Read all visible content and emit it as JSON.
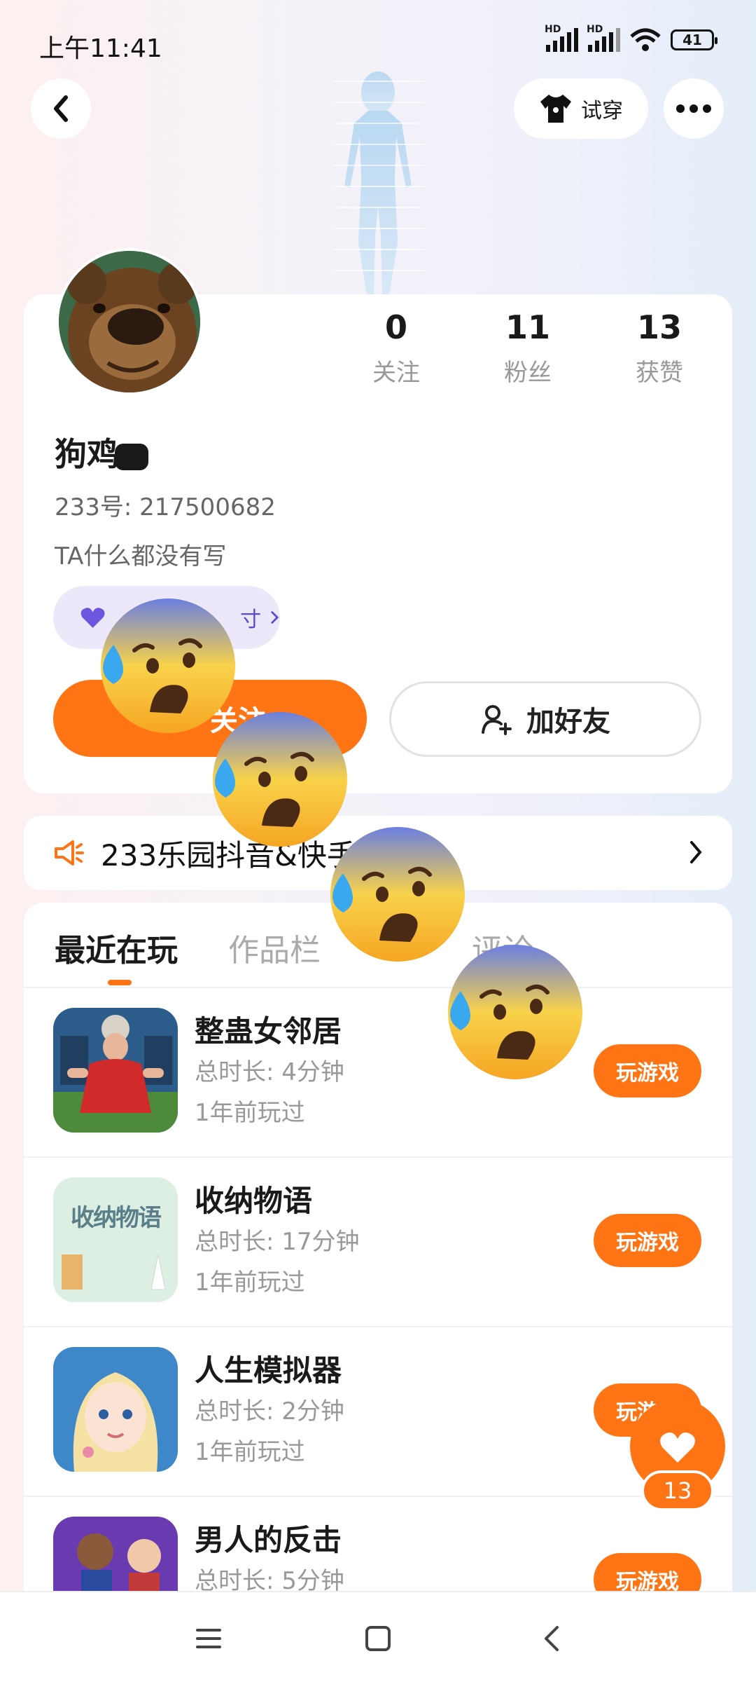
{
  "status_bar": {
    "time": "上午11:41",
    "battery": "41",
    "hd": "HD"
  },
  "header": {
    "tryon_label": "试穿"
  },
  "profile": {
    "stats": [
      {
        "value": "0",
        "label": "关注"
      },
      {
        "value": "11",
        "label": "粉丝"
      },
      {
        "value": "13",
        "label": "获赞"
      }
    ],
    "name": "狗鸡",
    "uid": "233号: 217500682",
    "bio": "TA什么都没有写",
    "tag_suffix": "寸",
    "follow_label": "关注",
    "addfriend_label": "加好友"
  },
  "notice": {
    "text": "233乐园抖音&快手指南"
  },
  "tabs": [
    {
      "label": "最近在玩"
    },
    {
      "label": "作品栏"
    },
    {
      "label": "评论"
    }
  ],
  "games": [
    {
      "name": "整蛊女邻居",
      "time": "总时长: 4分钟",
      "last": "1年前玩过",
      "play": "玩游戏"
    },
    {
      "name": "收纳物语",
      "time": "总时长: 17分钟",
      "last": "1年前玩过",
      "play": "玩游戏",
      "icon_text": "收纳物语"
    },
    {
      "name": "人生模拟器",
      "time": "总时长: 2分钟",
      "last": "1年前玩过",
      "play": "玩游戏"
    },
    {
      "name": "男人的反击",
      "time": "总时长: 5分钟",
      "last": "",
      "play": "玩游戏"
    }
  ],
  "like_float": {
    "count": "13"
  },
  "colors": {
    "accent": "#ff7414",
    "tag_bg": "#ece8fa",
    "tag_fg": "#5b4ad1"
  }
}
